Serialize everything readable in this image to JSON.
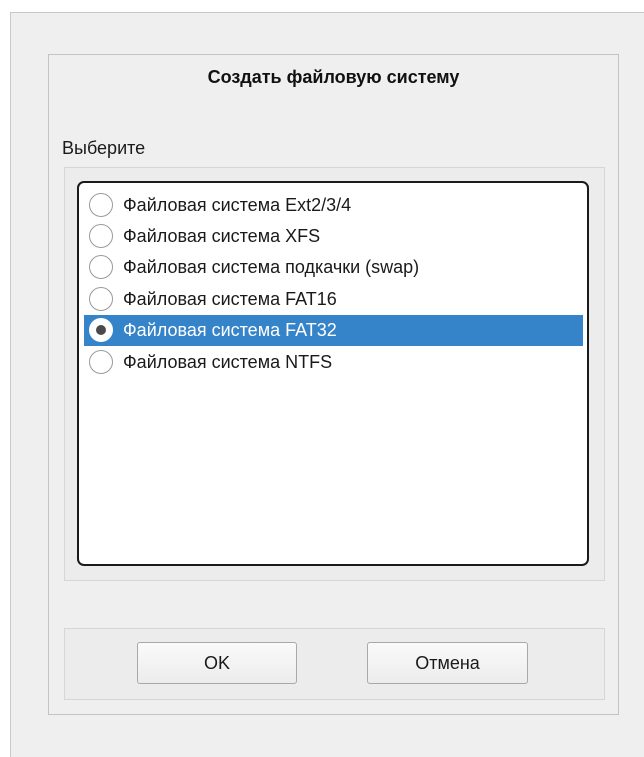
{
  "dialog": {
    "title": "Создать файловую систему",
    "section_label": "Выберите",
    "options": [
      {
        "label": "Файловая система Ext2/3/4",
        "selected": false
      },
      {
        "label": "Файловая система XFS",
        "selected": false
      },
      {
        "label": "Файловая система подкачки (swap)",
        "selected": false
      },
      {
        "label": "Файловая система FAT16",
        "selected": false
      },
      {
        "label": "Файловая система FAT32",
        "selected": true
      },
      {
        "label": "Файловая система NTFS",
        "selected": false
      }
    ],
    "buttons": {
      "ok_label": "OK",
      "cancel_label": "Отмена"
    }
  },
  "colors": {
    "selection_highlight": "#3583c9",
    "dialog_background": "#efefef",
    "list_background": "#ffffff"
  }
}
